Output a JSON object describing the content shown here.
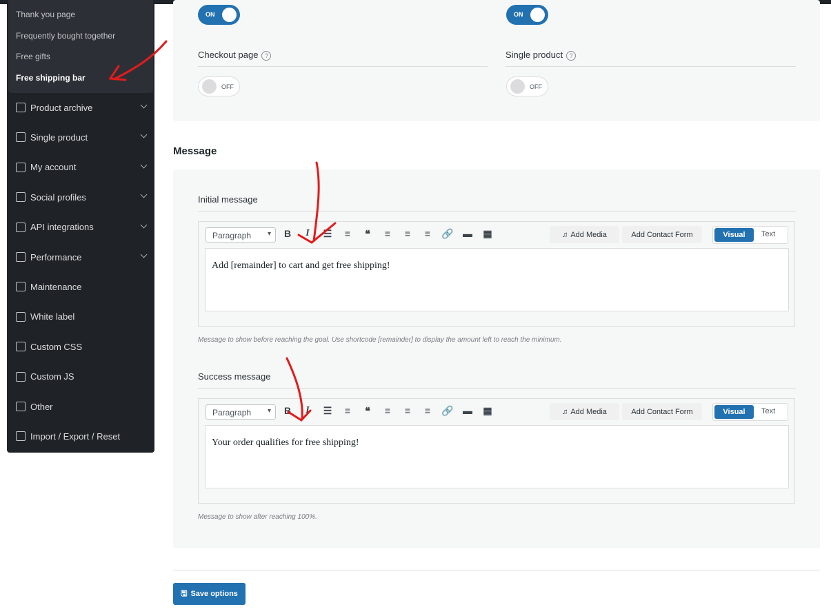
{
  "sidebar": {
    "submenu": [
      "Thank you page",
      "Frequently bought together",
      "Free gifts",
      "Free shipping bar"
    ],
    "items": [
      {
        "label": "Product archive",
        "chevron": true
      },
      {
        "label": "Single product",
        "chevron": true
      },
      {
        "label": "My account",
        "chevron": true
      },
      {
        "label": "Social profiles",
        "chevron": true
      },
      {
        "label": "API integrations",
        "chevron": true
      },
      {
        "label": "Performance",
        "chevron": true
      },
      {
        "label": "Maintenance"
      },
      {
        "label": "White label"
      },
      {
        "label": "Custom CSS"
      },
      {
        "label": "Custom JS"
      },
      {
        "label": "Other"
      },
      {
        "label": "Import / Export / Reset"
      }
    ]
  },
  "display": {
    "toggle1": "ON",
    "toggle2": "ON",
    "checkout_label": "Checkout page",
    "checkout_toggle": "OFF",
    "single_label": "Single product",
    "single_toggle": "OFF",
    "help": "?"
  },
  "message": {
    "heading": "Message",
    "initial": {
      "label": "Initial message",
      "format": "Paragraph",
      "content": "Add [remainder] to cart and get free shipping!",
      "help": "Message to show before reaching the goal. Use shortcode [remainder] to display the amount left to reach the minimum."
    },
    "success": {
      "label": "Success message",
      "format": "Paragraph",
      "content": "Your order qualifies for free shipping!",
      "help": "Message to show after reaching 100%."
    },
    "add_media": "Add Media",
    "add_contact_form": "Add Contact Form",
    "visual": "Visual",
    "text": "Text"
  },
  "save_label": "Save options"
}
